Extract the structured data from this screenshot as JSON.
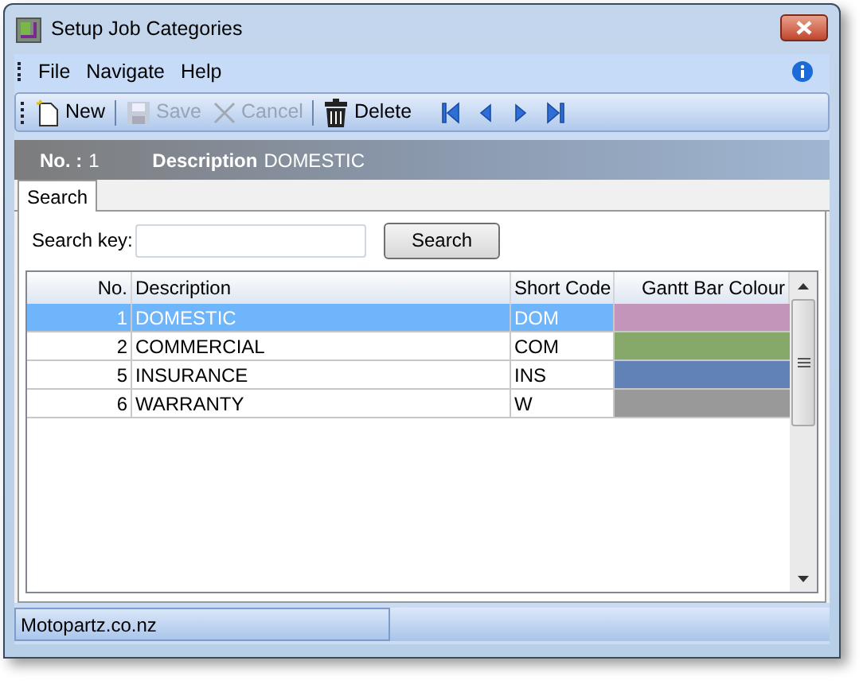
{
  "window": {
    "title": "Setup Job Categories"
  },
  "menu": [
    "File",
    "Navigate",
    "Help"
  ],
  "toolbar": [
    {
      "kind": "new",
      "label": "New",
      "disabled": false
    },
    {
      "kind": "save",
      "label": "Save",
      "disabled": true
    },
    {
      "kind": "cancel",
      "label": "Cancel",
      "disabled": true
    },
    {
      "kind": "delete",
      "label": "Delete",
      "disabled": false
    }
  ],
  "header": {
    "no_label": "No. :",
    "no_value": "1",
    "description_label": "Description",
    "description_value": "DOMESTIC"
  },
  "tabs": [
    {
      "label": "Search",
      "selected": true
    }
  ],
  "search": {
    "label": "Search key:",
    "button": "Search"
  },
  "table": {
    "columns": [
      "No.",
      "Description",
      "Short Code",
      "Gantt Bar Colour"
    ],
    "rows": [
      {
        "no": "1",
        "description": "DOMESTIC",
        "short_code": "DOM",
        "color": "#c495bb",
        "selected": true
      },
      {
        "no": "2",
        "description": "COMMERCIAL",
        "short_code": "COM",
        "color": "#86a96a",
        "selected": false
      },
      {
        "no": "5",
        "description": "INSURANCE",
        "short_code": "INS",
        "color": "#6082b6",
        "selected": false
      },
      {
        "no": "6",
        "description": "WARRANTY",
        "short_code": "W",
        "color": "#999999",
        "selected": false
      }
    ]
  },
  "status_bar": {
    "text": "Motopartz.co.nz"
  }
}
